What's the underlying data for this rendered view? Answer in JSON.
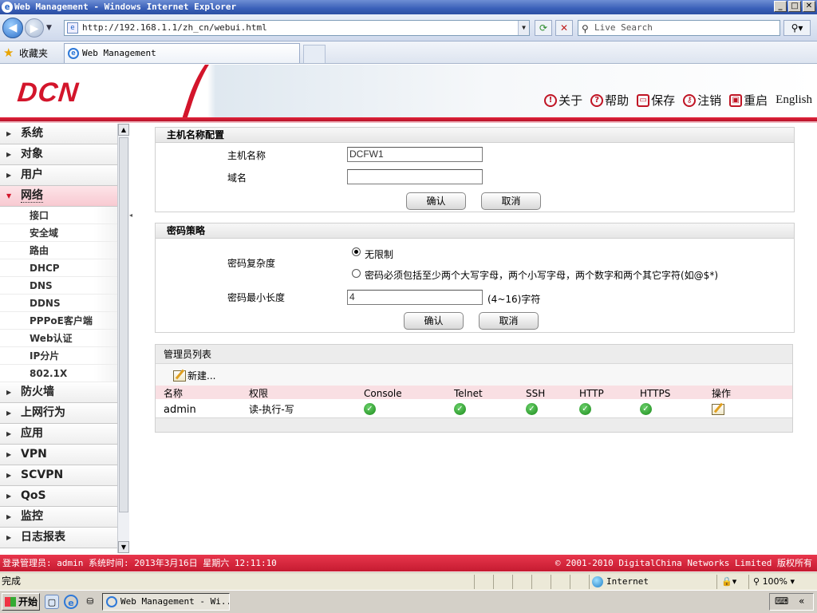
{
  "window": {
    "title": "Web Management - Windows Internet Explorer",
    "url": "http://192.168.1.1/zh_cn/webui.html",
    "search_placeholder": "Live Search",
    "favorites_label": "收藏夹",
    "tab_title": "Web Management"
  },
  "header": {
    "logo": "DCN",
    "menu": [
      {
        "label": "关于",
        "icon": "info-icon"
      },
      {
        "label": "帮助",
        "icon": "help-icon"
      },
      {
        "label": "保存",
        "icon": "save-icon"
      },
      {
        "label": "注销",
        "icon": "logout-key-icon"
      },
      {
        "label": "重启",
        "icon": "reboot-icon"
      }
    ],
    "language": "English"
  },
  "sidebar": {
    "items_top": [
      "系统",
      "对象",
      "用户"
    ],
    "open_item": "网络",
    "sub_items": [
      "接口",
      "安全域",
      "路由",
      "DHCP",
      "DNS",
      "DDNS",
      "PPPoE客户端",
      "Web认证",
      "IP分片",
      "802.1X"
    ],
    "items_bottom": [
      "防火墙",
      "上网行为",
      "应用",
      "VPN",
      "SCVPN",
      "QoS",
      "监控",
      "日志报表"
    ]
  },
  "hostname_panel": {
    "title": "主机名称配置",
    "hostname_label": "主机名称",
    "hostname_value": "DCFW1",
    "domain_label": "域名",
    "domain_value": "",
    "ok": "确认",
    "cancel": "取消"
  },
  "password_panel": {
    "title": "密码策略",
    "complexity_label": "密码复杂度",
    "option_unlimited": "无限制",
    "option_strict": "密码必须包括至少两个大写字母，两个小写字母，两个数字和两个其它字符(如@$*)",
    "selected": "无限制",
    "minlen_label": "密码最小长度",
    "minlen_value": "4",
    "minlen_hint": "(4~16)字符",
    "ok": "确认",
    "cancel": "取消"
  },
  "admin_panel": {
    "title": "管理员列表",
    "new_label": "新建...",
    "columns": [
      "名称",
      "权限",
      "Console",
      "Telnet",
      "SSH",
      "HTTP",
      "HTTPS",
      "操作"
    ],
    "rows": [
      {
        "name": "admin",
        "permission": "读-执行-写",
        "console": true,
        "telnet": true,
        "ssh": true,
        "http": true,
        "https": true
      }
    ]
  },
  "app_status": {
    "left": "登录管理员: admin 系统时间: 2013年3月16日 星期六 12:11:10",
    "right": "© 2001-2010 DigitalChina Networks Limited 版权所有"
  },
  "ie_status": {
    "left": "完成",
    "zone": "Internet",
    "zoom": "100%"
  },
  "taskbar": {
    "start": "开始",
    "task": "Web Management - Wi..."
  }
}
